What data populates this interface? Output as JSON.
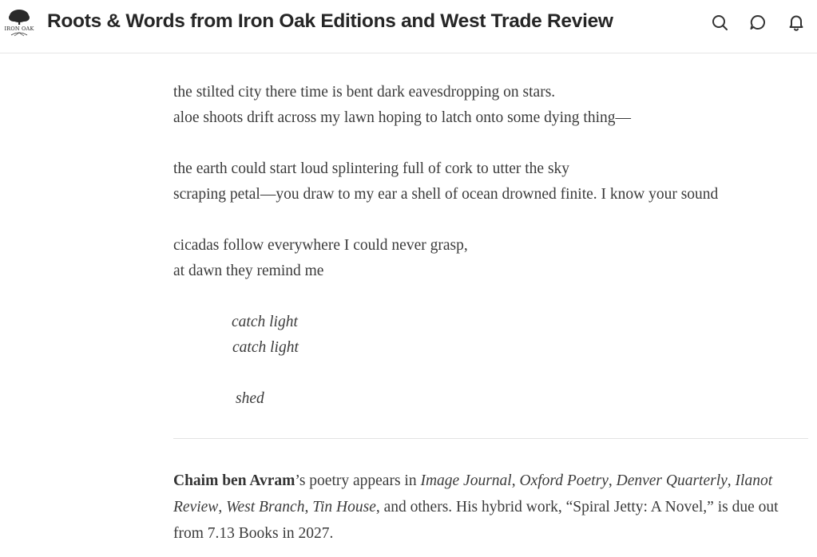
{
  "header": {
    "logo_text": "IRON OAK",
    "title": "Roots & Words from Iron Oak Editions and West Trade Review",
    "icons": [
      "search-icon",
      "comment-icon",
      "bell-icon"
    ]
  },
  "poem": {
    "stanza1": [
      "the stilted city there time is bent dark eavesdropping on stars.",
      "aloe shoots drift across my lawn hoping to latch onto some dying thing—"
    ],
    "stanza2": [
      "the earth could start loud splintering full of cork to utter the sky",
      "scraping petal—you draw to my ear a shell of ocean drowned finite. I know your sound"
    ],
    "stanza3": [
      "cicadas follow everywhere I could never grasp,",
      "at dawn they remind me"
    ],
    "italic_lines": [
      "catch light",
      "catch light",
      "shed"
    ]
  },
  "bio": {
    "author": "Chaim ben Avram",
    "t1": "’s poetry appears in ",
    "pub1": "Image Journal",
    "s1": ", ",
    "pub2": "Oxford Poetry",
    "s2": ", ",
    "pub3": "Denver Quarterly",
    "s3": ", ",
    "pub4": "Ilanot Review",
    "s4": ", ",
    "pub5": "West Branch",
    "s5": ", ",
    "pub6": "Tin House",
    "t2": ", and others. His hybrid work, “Spiral Jetty: A Novel,” is due out from 7.13 Books in 2027."
  },
  "colors": {
    "text": "#3b3b3b",
    "title": "#262626",
    "divider": "#e3e3e3"
  }
}
